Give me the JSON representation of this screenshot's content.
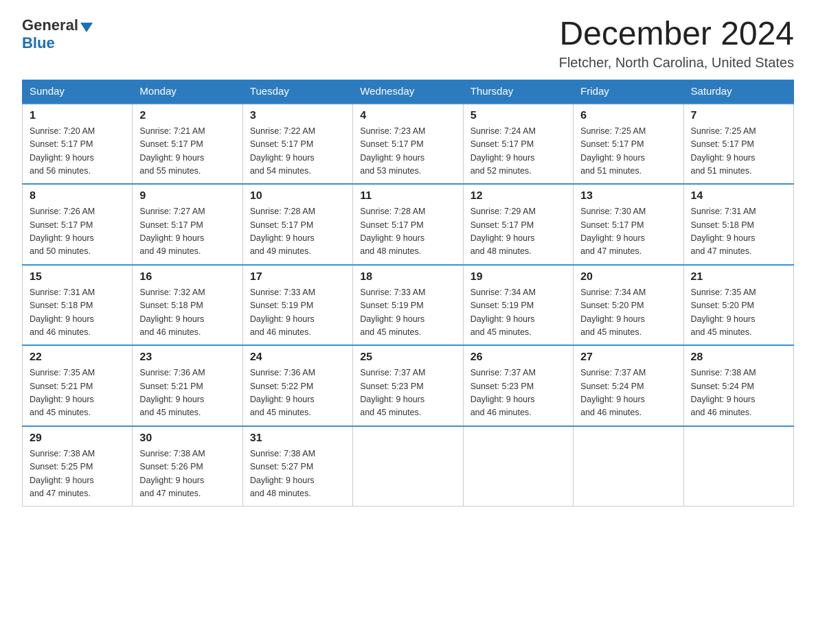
{
  "header": {
    "logo": {
      "general_text": "General",
      "blue_text": "Blue"
    },
    "title": "December 2024",
    "subtitle": "Fletcher, North Carolina, United States"
  },
  "days_of_week": [
    "Sunday",
    "Monday",
    "Tuesday",
    "Wednesday",
    "Thursday",
    "Friday",
    "Saturday"
  ],
  "weeks": [
    [
      {
        "day": "1",
        "sunrise": "7:20 AM",
        "sunset": "5:17 PM",
        "daylight": "9 hours and 56 minutes."
      },
      {
        "day": "2",
        "sunrise": "7:21 AM",
        "sunset": "5:17 PM",
        "daylight": "9 hours and 55 minutes."
      },
      {
        "day": "3",
        "sunrise": "7:22 AM",
        "sunset": "5:17 PM",
        "daylight": "9 hours and 54 minutes."
      },
      {
        "day": "4",
        "sunrise": "7:23 AM",
        "sunset": "5:17 PM",
        "daylight": "9 hours and 53 minutes."
      },
      {
        "day": "5",
        "sunrise": "7:24 AM",
        "sunset": "5:17 PM",
        "daylight": "9 hours and 52 minutes."
      },
      {
        "day": "6",
        "sunrise": "7:25 AM",
        "sunset": "5:17 PM",
        "daylight": "9 hours and 51 minutes."
      },
      {
        "day": "7",
        "sunrise": "7:25 AM",
        "sunset": "5:17 PM",
        "daylight": "9 hours and 51 minutes."
      }
    ],
    [
      {
        "day": "8",
        "sunrise": "7:26 AM",
        "sunset": "5:17 PM",
        "daylight": "9 hours and 50 minutes."
      },
      {
        "day": "9",
        "sunrise": "7:27 AM",
        "sunset": "5:17 PM",
        "daylight": "9 hours and 49 minutes."
      },
      {
        "day": "10",
        "sunrise": "7:28 AM",
        "sunset": "5:17 PM",
        "daylight": "9 hours and 49 minutes."
      },
      {
        "day": "11",
        "sunrise": "7:28 AM",
        "sunset": "5:17 PM",
        "daylight": "9 hours and 48 minutes."
      },
      {
        "day": "12",
        "sunrise": "7:29 AM",
        "sunset": "5:17 PM",
        "daylight": "9 hours and 48 minutes."
      },
      {
        "day": "13",
        "sunrise": "7:30 AM",
        "sunset": "5:17 PM",
        "daylight": "9 hours and 47 minutes."
      },
      {
        "day": "14",
        "sunrise": "7:31 AM",
        "sunset": "5:18 PM",
        "daylight": "9 hours and 47 minutes."
      }
    ],
    [
      {
        "day": "15",
        "sunrise": "7:31 AM",
        "sunset": "5:18 PM",
        "daylight": "9 hours and 46 minutes."
      },
      {
        "day": "16",
        "sunrise": "7:32 AM",
        "sunset": "5:18 PM",
        "daylight": "9 hours and 46 minutes."
      },
      {
        "day": "17",
        "sunrise": "7:33 AM",
        "sunset": "5:19 PM",
        "daylight": "9 hours and 46 minutes."
      },
      {
        "day": "18",
        "sunrise": "7:33 AM",
        "sunset": "5:19 PM",
        "daylight": "9 hours and 45 minutes."
      },
      {
        "day": "19",
        "sunrise": "7:34 AM",
        "sunset": "5:19 PM",
        "daylight": "9 hours and 45 minutes."
      },
      {
        "day": "20",
        "sunrise": "7:34 AM",
        "sunset": "5:20 PM",
        "daylight": "9 hours and 45 minutes."
      },
      {
        "day": "21",
        "sunrise": "7:35 AM",
        "sunset": "5:20 PM",
        "daylight": "9 hours and 45 minutes."
      }
    ],
    [
      {
        "day": "22",
        "sunrise": "7:35 AM",
        "sunset": "5:21 PM",
        "daylight": "9 hours and 45 minutes."
      },
      {
        "day": "23",
        "sunrise": "7:36 AM",
        "sunset": "5:21 PM",
        "daylight": "9 hours and 45 minutes."
      },
      {
        "day": "24",
        "sunrise": "7:36 AM",
        "sunset": "5:22 PM",
        "daylight": "9 hours and 45 minutes."
      },
      {
        "day": "25",
        "sunrise": "7:37 AM",
        "sunset": "5:23 PM",
        "daylight": "9 hours and 45 minutes."
      },
      {
        "day": "26",
        "sunrise": "7:37 AM",
        "sunset": "5:23 PM",
        "daylight": "9 hours and 46 minutes."
      },
      {
        "day": "27",
        "sunrise": "7:37 AM",
        "sunset": "5:24 PM",
        "daylight": "9 hours and 46 minutes."
      },
      {
        "day": "28",
        "sunrise": "7:38 AM",
        "sunset": "5:24 PM",
        "daylight": "9 hours and 46 minutes."
      }
    ],
    [
      {
        "day": "29",
        "sunrise": "7:38 AM",
        "sunset": "5:25 PM",
        "daylight": "9 hours and 47 minutes."
      },
      {
        "day": "30",
        "sunrise": "7:38 AM",
        "sunset": "5:26 PM",
        "daylight": "9 hours and 47 minutes."
      },
      {
        "day": "31",
        "sunrise": "7:38 AM",
        "sunset": "5:27 PM",
        "daylight": "9 hours and 48 minutes."
      },
      null,
      null,
      null,
      null
    ]
  ],
  "labels": {
    "sunrise": "Sunrise:",
    "sunset": "Sunset:",
    "daylight": "Daylight:"
  }
}
